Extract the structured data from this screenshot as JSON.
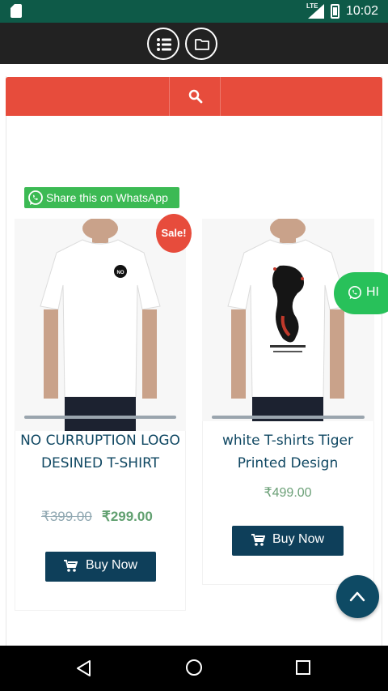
{
  "status_bar": {
    "time": "10:02",
    "network": "LTE",
    "icons": [
      "sd-card-icon",
      "signal-icon",
      "battery-icon"
    ]
  },
  "toolbar": {
    "buttons": [
      {
        "icon": "list-icon"
      },
      {
        "icon": "folder-icon"
      }
    ]
  },
  "search": {
    "icon": "search-icon",
    "bar_color": "#e74c3c"
  },
  "share": {
    "label": "Share this on WhatsApp",
    "icon": "whatsapp-icon",
    "color": "#3cba54"
  },
  "products": [
    {
      "title": "NO CURRUPTION LOGO DESINED T-SHIRT",
      "badge": "Sale!",
      "old_price": "₹399.00",
      "price": "₹299.00",
      "button_label": "Buy Now",
      "image": "white-tshirt-no-logo"
    },
    {
      "title": "white T-shirts Tiger Printed Design",
      "price": "₹499.00",
      "button_label": "Buy Now",
      "image": "white-tshirt-tiger-print"
    }
  ],
  "whatsapp_float": {
    "label": "HI",
    "color": "#28c15a"
  },
  "scroll_top": {
    "icon": "chevron-up-icon"
  },
  "nav": {
    "icons": [
      "back-icon",
      "home-icon",
      "recents-icon"
    ]
  },
  "colors": {
    "accent": "#e74c3c",
    "primary": "#0e3f5a",
    "status": "#0e5a48",
    "price_green": "#61a070"
  }
}
